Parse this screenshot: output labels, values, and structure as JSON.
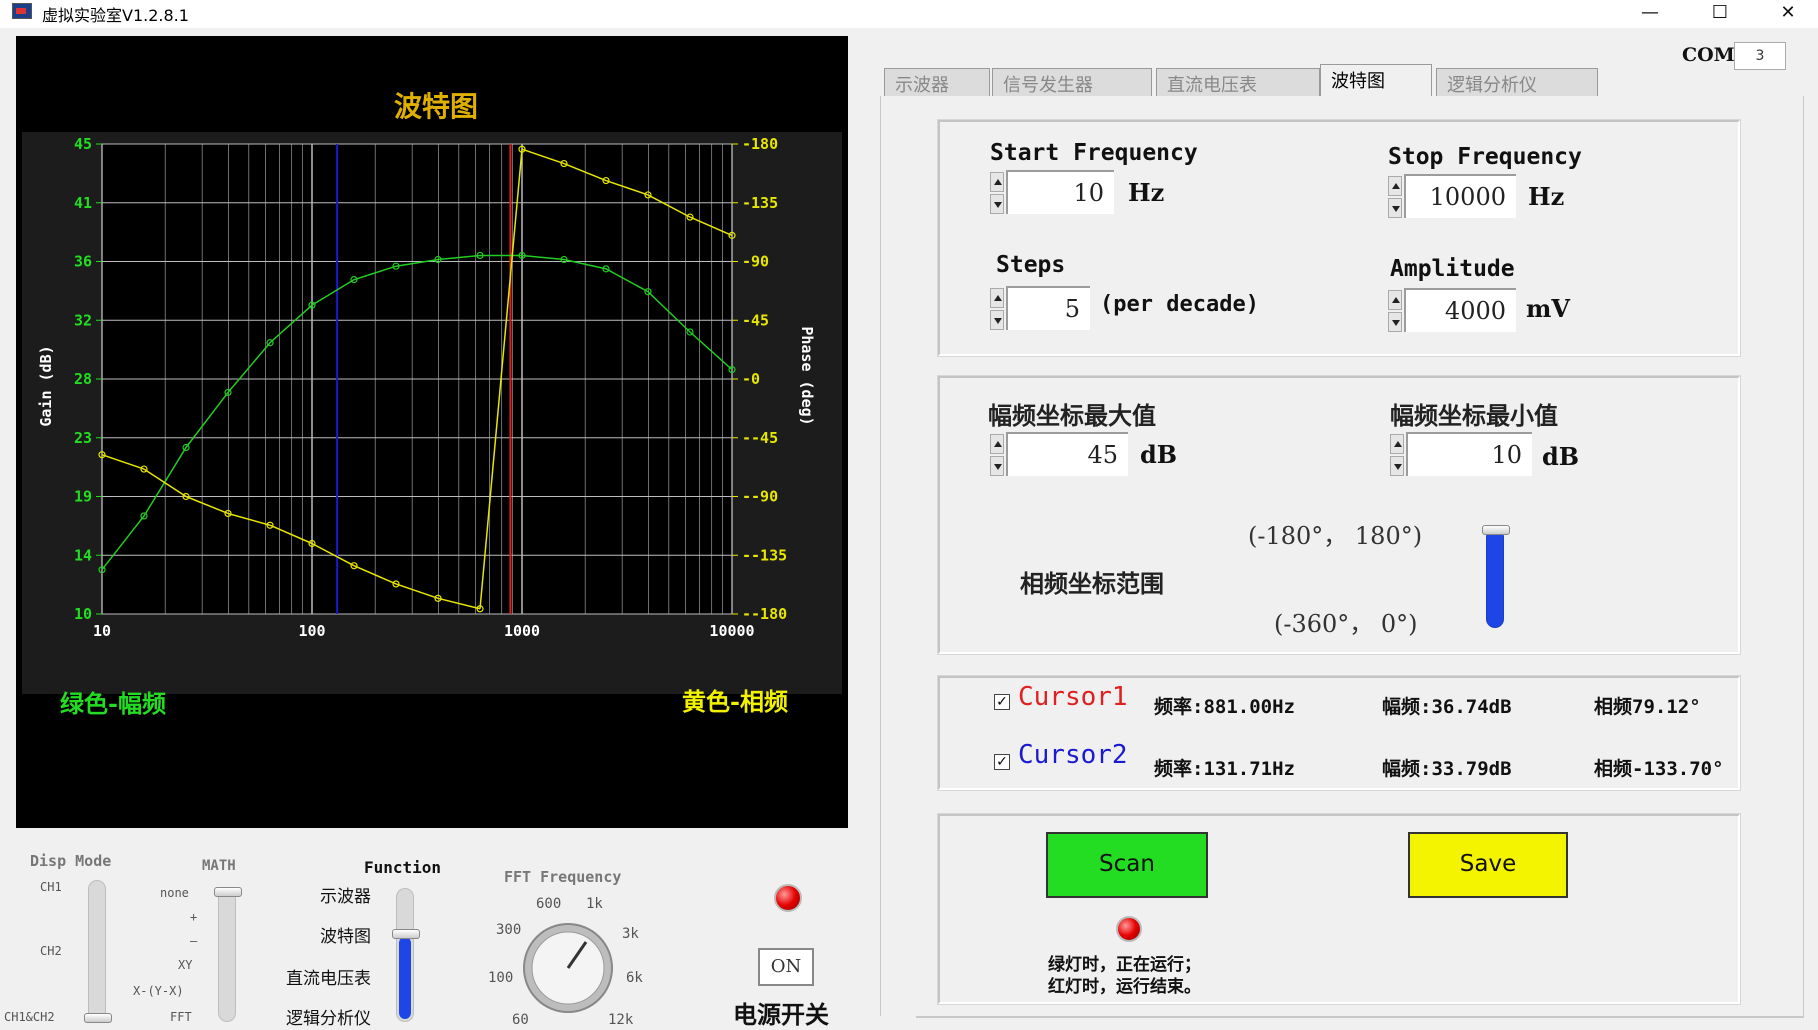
{
  "window": {
    "title": "虚拟实验室V1.2.8.1",
    "minimize": "—",
    "maximize": "☐",
    "close": "✕"
  },
  "plot": {
    "title": "波特图",
    "gain_axis_label": "Gain (dB)",
    "phase_axis_label": "Phase (deg)",
    "legend_gain": "绿色-幅频",
    "legend_phase": "黄色-相频",
    "colors": {
      "gain": "#22cc22",
      "phase": "#e6e600",
      "cursor1": "#e02020",
      "cursor2": "#1a1ad0"
    }
  },
  "chart_data": {
    "type": "line",
    "x_scale": "log",
    "xlim": [
      10,
      10000
    ],
    "x_ticks": [
      "10",
      "100",
      "1000",
      "10000"
    ],
    "gain_ylim": [
      10,
      45
    ],
    "gain_ticks": [
      "45",
      "41",
      "36",
      "32",
      "28",
      "23",
      "19",
      "14",
      "10"
    ],
    "phase_ylim": [
      -180,
      180
    ],
    "phase_ticks": [
      "180",
      "135",
      "90",
      "45",
      "0",
      "-45",
      "-90",
      "-135",
      "-180"
    ],
    "series": [
      {
        "name": "绿色-幅频",
        "axis": "gain",
        "x": [
          10,
          15.85,
          25.12,
          39.81,
          63.1,
          100,
          158.5,
          251.2,
          398.1,
          631,
          1000,
          1585,
          2512,
          3981,
          6310,
          10000
        ],
        "y": [
          13.3,
          17.3,
          22.4,
          26.5,
          30.2,
          33.0,
          34.9,
          35.9,
          36.4,
          36.7,
          36.7,
          36.4,
          35.7,
          34.0,
          31.0,
          28.2
        ]
      },
      {
        "name": "黄色-相频",
        "axis": "phase",
        "x": [
          10,
          15.85,
          25.12,
          39.81,
          63.1,
          100,
          158.5,
          251.2,
          398.1,
          631,
          1000,
          1585,
          2512,
          3981,
          6310,
          10000
        ],
        "y": [
          -58,
          -69,
          -90,
          -103,
          -112,
          -126,
          -143,
          -157,
          -168,
          -176,
          176,
          165,
          152,
          141,
          124,
          110
        ]
      }
    ],
    "cursors": [
      {
        "name": "Cursor1",
        "x": 881
      },
      {
        "name": "Cursor2",
        "x": 131.71
      }
    ]
  },
  "left_controls": {
    "disp_mode": {
      "title": "Disp Mode",
      "options": [
        "CH1",
        "CH2",
        "CH1&CH2"
      ]
    },
    "math": {
      "title": "MATH",
      "options": [
        "none",
        "+",
        "—",
        "XY",
        "X-(Y-X)",
        "FFT"
      ]
    },
    "function": {
      "title": "Function",
      "options": [
        "示波器",
        "波特图",
        "直流电压表",
        "逻辑分析仪"
      ],
      "selected": "波特图"
    },
    "fft": {
      "title": "FFT Frequency",
      "ticks": [
        "600",
        "1k",
        "300",
        "3k",
        "100",
        "6k",
        "60",
        "12k"
      ]
    },
    "power": {
      "button": "ON",
      "label": "电源开关"
    }
  },
  "com": {
    "label": "COM",
    "value": "3"
  },
  "tabs": [
    {
      "label": "示波器",
      "active": false
    },
    {
      "label": "信号发生器",
      "active": false
    },
    {
      "label": "直流电压表",
      "active": false
    },
    {
      "label": "波特图",
      "active": true
    },
    {
      "label": "逻辑分析仪",
      "active": false
    }
  ],
  "freq": {
    "start_label": "Start Frequency",
    "start_value": "10",
    "start_unit": "Hz",
    "stop_label": "Stop Frequency",
    "stop_value": "10000",
    "stop_unit": "Hz",
    "steps_label": "Steps",
    "steps_value": "5",
    "steps_unit": "(per decade)",
    "amp_label": "Amplitude",
    "amp_value": "4000",
    "amp_unit": "mV"
  },
  "axes": {
    "max_label": "幅频坐标最大值",
    "max_value": "45",
    "max_unit": "dB",
    "min_label": "幅频坐标最小值",
    "min_value": "10",
    "min_unit": "dB",
    "phase_label": "相频坐标范围",
    "range_top": "(-180°， 180°)",
    "range_bottom": "(-360°， 0°)"
  },
  "cursors": [
    {
      "check": "✓",
      "name": "Cursor1",
      "freq": "频率:881.00Hz",
      "gain": "幅频:36.74dB",
      "phase": "相频79.12°"
    },
    {
      "check": "✓",
      "name": "Cursor2",
      "freq": "频率:131.71Hz",
      "gain": "幅频:33.79dB",
      "phase": "相频-133.70°"
    }
  ],
  "actions": {
    "scan": "Scan",
    "save": "Save",
    "note_line1": "绿灯时，正在运行；",
    "note_line2": "红灯时，运行结束。"
  }
}
